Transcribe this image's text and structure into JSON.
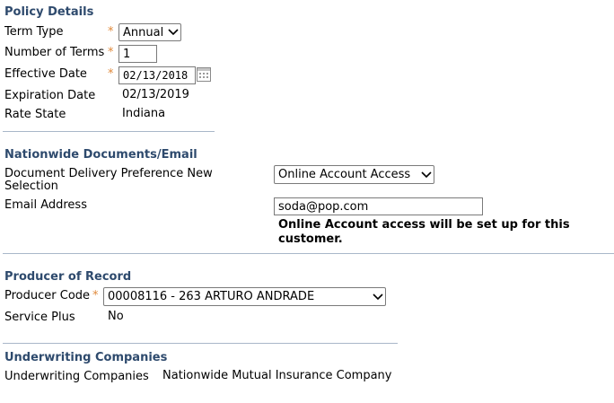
{
  "policy_details": {
    "title": "Policy Details",
    "term_type": {
      "label": "Term Type",
      "value": "Annual"
    },
    "number_of_terms": {
      "label": "Number of Terms",
      "value": "1"
    },
    "effective_date": {
      "label": "Effective Date",
      "value": "02/13/2018"
    },
    "expiration_date": {
      "label": "Expiration Date",
      "value": "02/13/2019"
    },
    "rate_state": {
      "label": "Rate State",
      "value": "Indiana"
    },
    "required_marker": "*"
  },
  "documents_email": {
    "title": "Nationwide Documents/Email",
    "delivery": {
      "label_line1": "Document Delivery Preference New",
      "label_line2": "Selection",
      "value": "Online Account Access"
    },
    "email": {
      "label": "Email Address",
      "value": "soda@pop.com"
    },
    "note_line1": "Online Account access will be set up for this",
    "note_line2": "customer."
  },
  "producer": {
    "title": "Producer of Record",
    "producer_code": {
      "label": "Producer Code",
      "value": "00008116 - 263 ARTURO ANDRADE"
    },
    "service_plus": {
      "label": "Service Plus",
      "value": "No"
    }
  },
  "underwriting": {
    "title": "Underwriting Companies",
    "companies": {
      "label": "Underwriting Companies",
      "value": "Nationwide Mutual Insurance Company"
    }
  },
  "colors": {
    "section_title": "#2e4a6d",
    "required_marker": "#e08a3c",
    "divider": "#a9b7c9"
  },
  "icons": {
    "dropdown": "chevron-down-icon",
    "calendar": "calendar-icon"
  }
}
